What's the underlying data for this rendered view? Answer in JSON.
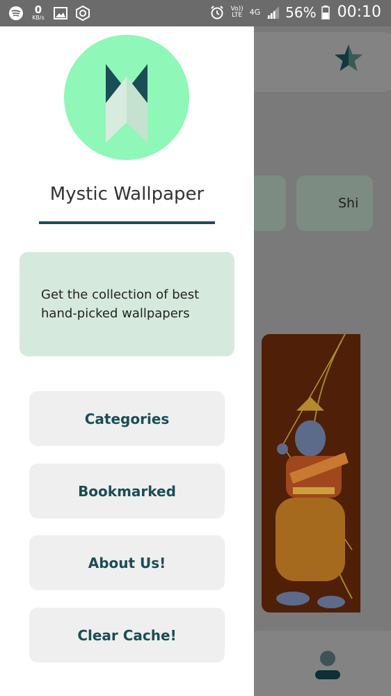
{
  "status_bar": {
    "data_rate_value": "0",
    "data_rate_unit": "KB/s",
    "volte_label": "Vo)) LTE",
    "network_label": "4G",
    "battery_percent": "56%",
    "time": "00:10",
    "icons": [
      "spotify-icon",
      "image-icon",
      "app-icon",
      "alarm-icon",
      "signal-icon",
      "battery-icon"
    ]
  },
  "drawer": {
    "app_title": "Mystic Wallpaper",
    "tagline": "Get the collection of best hand-picked wallpapers",
    "menu": [
      {
        "label": "Categories"
      },
      {
        "label": "Bookmarked"
      },
      {
        "label": "About Us!"
      },
      {
        "label": "Clear Cache!"
      }
    ]
  },
  "background": {
    "category_chip_label": "Shi",
    "icons": [
      "star-icon",
      "profile-icon"
    ]
  },
  "colors": {
    "accent": "#1b4d55",
    "logo_bg": "#8ff7b7",
    "card_bg": "#d5eadd",
    "button_bg": "#efefef"
  }
}
